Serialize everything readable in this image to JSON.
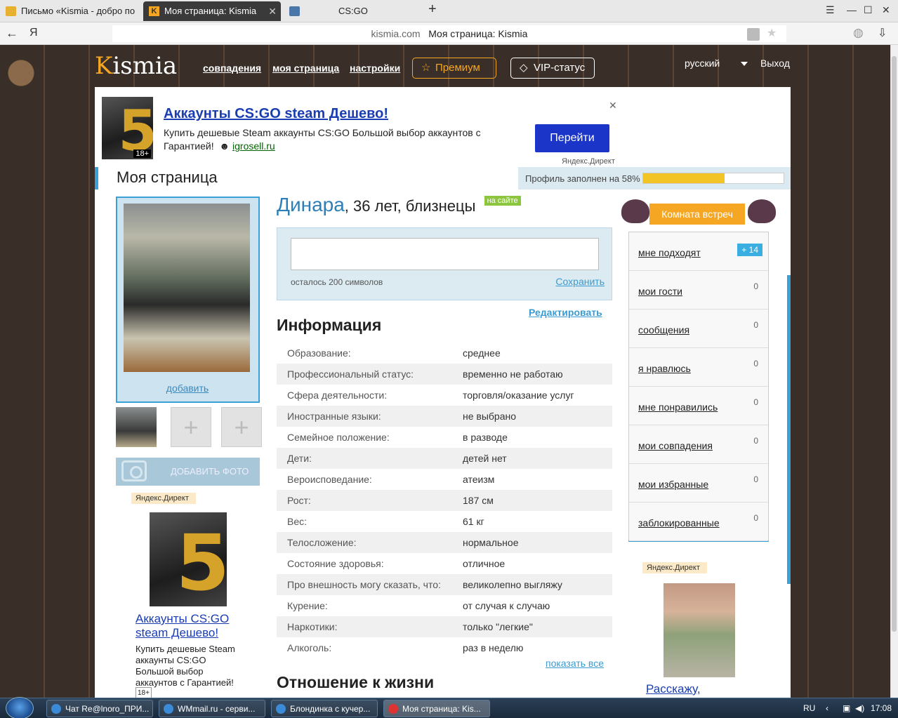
{
  "browser": {
    "tabs": [
      {
        "label": "Письмо «Kismia - добро по"
      },
      {
        "label": "Моя страница: Kismia"
      },
      {
        "label": ""
      },
      {
        "label": "CS:GO"
      }
    ],
    "address_domain": "kismia.com",
    "address_title": "Моя страница: Kismia",
    "yandex_letter": "Я"
  },
  "site": {
    "logo_k": "K",
    "logo_rest": "ismia",
    "nav": {
      "matches": "совпадения",
      "mypage": "моя страница",
      "settings": "настройки"
    },
    "premium": "Премиум",
    "vip": "VIP-статус",
    "lang": "русский",
    "logout": "Выход"
  },
  "ad_top": {
    "title": "Аккаунты CS:GO steam Дешево!",
    "text": "Купить дешевые Steam аккаунты CS:GO Большой выбор аккаунтов с Гарантией!",
    "link": "igrosell.ru",
    "button": "Перейти",
    "source": "Яндекс.Директ",
    "age": "18+"
  },
  "page": {
    "title": "Моя страница",
    "profile_fill_label": "Профиль заполнен на 58%",
    "profile_fill_value": 0.58
  },
  "profile": {
    "name": "Динара",
    "details": ", 36 лет, близнецы",
    "online": "на сайте",
    "photo_add": "добавить",
    "add_photo": "ДОБАВИТЬ ФОТО",
    "status_left": "осталось 200 символов",
    "status_save": "Сохранить",
    "edit": "Редактировать",
    "info_title": "Информация",
    "info": [
      {
        "k": "Образование:",
        "v": "среднее"
      },
      {
        "k": "Профессиональный статус:",
        "v": "временно не работаю"
      },
      {
        "k": "Сфера деятельности:",
        "v": "торговля/оказание услуг"
      },
      {
        "k": "Иностранные языки:",
        "v": "не выбрано"
      },
      {
        "k": "Семейное положение:",
        "v": "в разводе"
      },
      {
        "k": "Дети:",
        "v": "детей нет"
      },
      {
        "k": "Вероисповедание:",
        "v": "атеизм"
      },
      {
        "k": "Рост:",
        "v": "187 см"
      },
      {
        "k": "Вес:",
        "v": "61 кг"
      },
      {
        "k": "Телосложение:",
        "v": "нормальное"
      },
      {
        "k": "Состояние здоровья:",
        "v": "отличное"
      },
      {
        "k": "Про внешность могу сказать, что:",
        "v": "великолепно выгляжу"
      },
      {
        "k": "Курение:",
        "v": "от случая к случаю"
      },
      {
        "k": "Наркотики:",
        "v": "только \"легкие\""
      },
      {
        "k": "Алкоголь:",
        "v": "раз в неделю"
      }
    ],
    "show_all": "показать все",
    "life_title": "Отношение к жизни"
  },
  "ad_left": {
    "source": "Яндекс.Директ",
    "title": "Аккаунты CS:GO steam Дешево!",
    "text": "Купить дешевые Steam аккаунты CS:GO Большой выбор аккаунтов с Гарантией!",
    "age": "18+"
  },
  "ad_right": {
    "source": "Яндекс.Директ",
    "title": "Расскажу,"
  },
  "sidebar": {
    "room": "Комната встреч",
    "items": [
      {
        "label": "мне подходят",
        "count": "+ 14"
      },
      {
        "label": "мои гости",
        "count": "0"
      },
      {
        "label": "сообщения",
        "count": "0"
      },
      {
        "label": "я нравлюсь",
        "count": "0"
      },
      {
        "label": "мне понравились",
        "count": "0"
      },
      {
        "label": "мои совпадения",
        "count": "0"
      },
      {
        "label": "мои избранные",
        "count": "0"
      },
      {
        "label": "заблокированные",
        "count": "0"
      }
    ]
  },
  "taskbar": {
    "items": [
      "Чат Re@lnoro_ПРИ...",
      "WMmail.ru - серви...",
      "Блондинка с кучер...",
      "Моя страница: Kis..."
    ],
    "lang": "RU",
    "time": "17:08"
  }
}
